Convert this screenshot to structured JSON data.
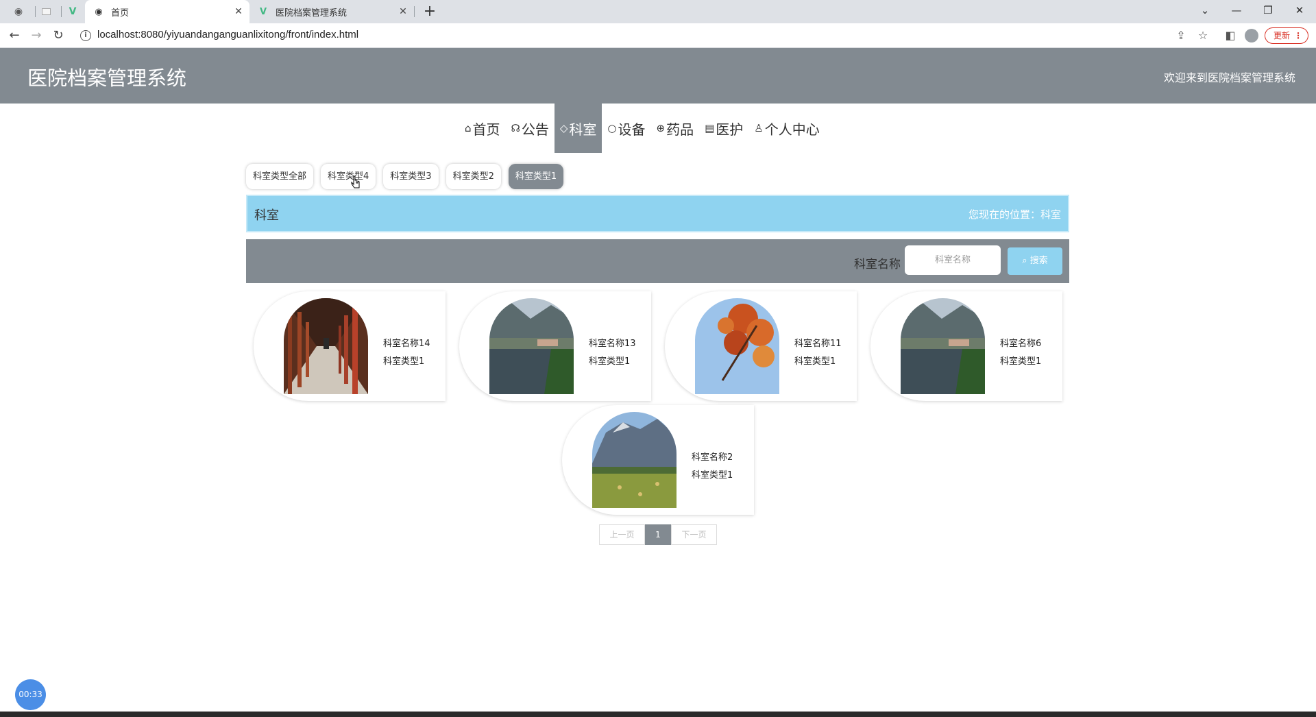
{
  "browser": {
    "tabs": [
      {
        "title": "首页",
        "icon": "globe-icon"
      },
      {
        "title": "医院档案管理系统",
        "icon": "vue-icon"
      }
    ],
    "url": "localhost:8080/yiyuandanganguanlixitong/front/index.html",
    "update_label": "更新"
  },
  "header": {
    "site_title": "医院档案管理系统",
    "welcome": "欢迎来到医院档案管理系统"
  },
  "nav": {
    "items": [
      {
        "label": "首页",
        "icon": "home-icon"
      },
      {
        "label": "公告",
        "icon": "megaphone-icon"
      },
      {
        "label": "科室",
        "icon": "tag-icon",
        "active": true
      },
      {
        "label": "设备",
        "icon": "circle-icon"
      },
      {
        "label": "药品",
        "icon": "globe-icon"
      },
      {
        "label": "医护",
        "icon": "calendar-icon"
      },
      {
        "label": "个人中心",
        "icon": "user-icon"
      }
    ]
  },
  "categories": {
    "items": [
      "科室类型全部",
      "科室类型4",
      "科室类型3",
      "科室类型2",
      "科室类型1"
    ],
    "active_index": 4
  },
  "breadcrumb": {
    "title": "科室",
    "position": "您现在的位置：科室"
  },
  "search": {
    "label": "科室名称",
    "placeholder": "科室名称",
    "button_label": "搜索"
  },
  "cards": [
    {
      "name": "科室名称14",
      "type": "科室类型1",
      "image": "corridor"
    },
    {
      "name": "科室名称13",
      "type": "科室类型1",
      "image": "lake-village"
    },
    {
      "name": "科室名称11",
      "type": "科室类型1",
      "image": "autumn-leaves"
    },
    {
      "name": "科室名称6",
      "type": "科室类型1",
      "image": "lake-village"
    },
    {
      "name": "科室名称2",
      "type": "科室类型1",
      "image": "mountain-field"
    }
  ],
  "pagination": {
    "prev": "上一页",
    "current": "1",
    "next": "下一页"
  },
  "timer": "00:33",
  "colors": {
    "header_bg": "#828a91",
    "breadcrumb_bg": "#8fd3f0",
    "search_button": "#8fd3f0"
  }
}
